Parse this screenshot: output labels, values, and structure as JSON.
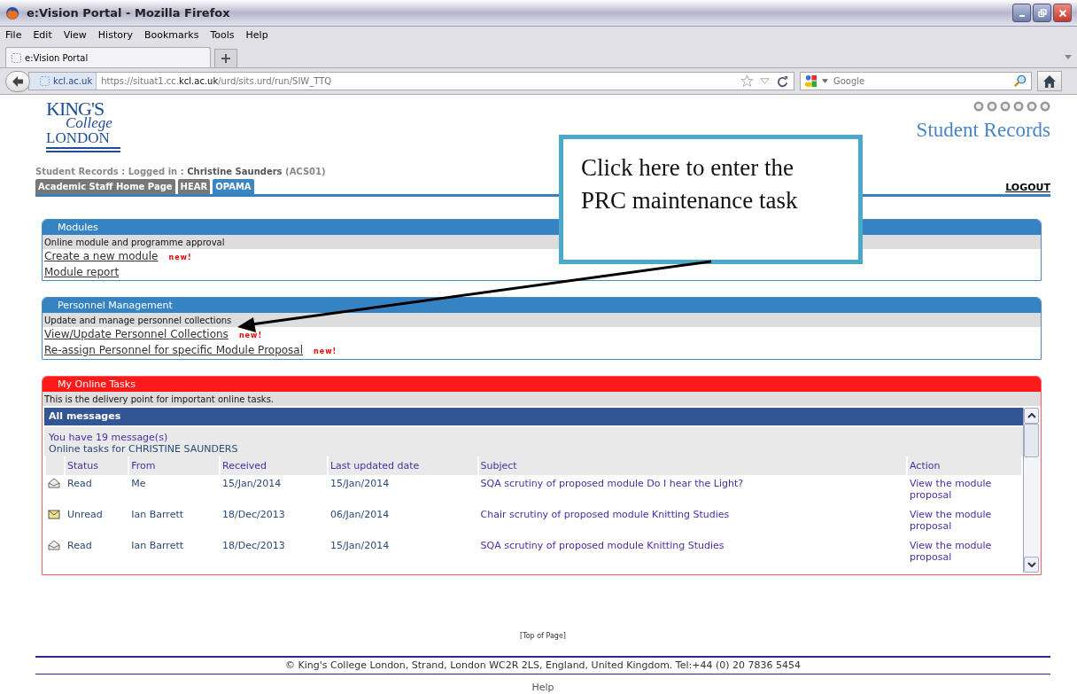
{
  "window": {
    "title": "e:Vision Portal - Mozilla Firefox"
  },
  "menu": [
    "File",
    "Edit",
    "View",
    "History",
    "Bookmarks",
    "Tools",
    "Help"
  ],
  "browser_tab": {
    "title": "e:Vision Portal"
  },
  "address_bar": {
    "site": "kcl.ac.uk",
    "url_start": "https://situat1.cc.",
    "url_domain": "kcl.ac.uk",
    "url_rest": "/urd/sits.urd/run/SIW_TTQ"
  },
  "search": {
    "placeholder": "Google"
  },
  "logo": {
    "line1": "KING'S",
    "line2": "College",
    "line3": "LONDON"
  },
  "site_title": "Student Records",
  "login_line": {
    "prefix": "Student Records : Logged in : ",
    "name": "Christine Saunders",
    "code": "(ACS01)"
  },
  "tabs": [
    {
      "label": "Academic Staff Home Page",
      "selected": false
    },
    {
      "label": "HEAR",
      "selected": false
    },
    {
      "label": "OPAMA",
      "selected": true
    }
  ],
  "logout": "LOGOUT",
  "panels": [
    {
      "title": "Modules",
      "kind": "blue",
      "description": "Online module and programme approval",
      "links": [
        {
          "label": "Create a new module",
          "badge": "new!"
        },
        {
          "label": "Module report"
        }
      ]
    },
    {
      "title": "Personnel Management",
      "kind": "blue",
      "description": "Update and manage personnel collections",
      "links": [
        {
          "label": "View/Update Personnel Collections",
          "badge": "new!"
        },
        {
          "label": "Re-assign Personnel for specific Module Proposal",
          "badge": "new!"
        }
      ]
    }
  ],
  "tasks": {
    "title": "My Online Tasks",
    "description": "This is the delivery point for important online tasks.",
    "header": "All messages",
    "count": "You have 19 message(s)",
    "owner": "Online tasks for CHRISTINE SAUNDERS",
    "columns": [
      "Status",
      "From",
      "Received",
      "Last updated date",
      "Subject",
      "Action"
    ],
    "rows": [
      {
        "kind": "read",
        "status": "Read",
        "from": "Me",
        "received": "15/Jan/2014",
        "updated": "15/Jan/2014",
        "subject": "SQA scrutiny of proposed module Do I hear the Light?",
        "action": "View the module proposal"
      },
      {
        "kind": "unread",
        "status": "Unread",
        "from": "Ian Barrett",
        "received": "18/Dec/2013",
        "updated": "06/Jan/2014",
        "subject": "Chair scrutiny of proposed module Knitting Studies",
        "action": "View the module proposal"
      },
      {
        "kind": "read",
        "status": "Read",
        "from": "Ian Barrett",
        "received": "18/Dec/2013",
        "updated": "15/Jan/2014",
        "subject": "SQA scrutiny of proposed module Knitting Studies",
        "action": "View the module proposal"
      }
    ]
  },
  "callout": "Click here to enter the PRC maintenance task",
  "top_link": "[Top of Page]",
  "footer": {
    "copyright": "© King's College London, Strand, London WC2R 2LS, England, United Kingdom. Tel:+44 (0) 20 7836 5454",
    "help": "Help"
  }
}
